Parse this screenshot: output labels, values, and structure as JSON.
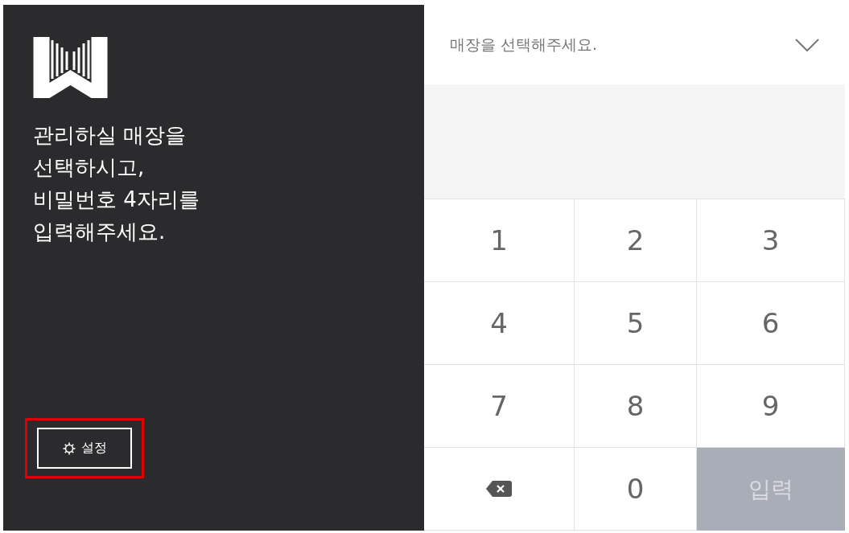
{
  "intro": {
    "lines": [
      "관리하실 매장을",
      "선택하시고,",
      "비밀번호 4자리를",
      "입력해주세요."
    ]
  },
  "settings": {
    "label": "설정",
    "highlighted": true
  },
  "store_select": {
    "placeholder": "매장을 선택해주세요."
  },
  "keypad": [
    {
      "kind": "digit",
      "label": "1"
    },
    {
      "kind": "digit",
      "label": "2"
    },
    {
      "kind": "digit",
      "label": "3"
    },
    {
      "kind": "digit",
      "label": "4"
    },
    {
      "kind": "digit",
      "label": "5"
    },
    {
      "kind": "digit",
      "label": "6"
    },
    {
      "kind": "digit",
      "label": "7"
    },
    {
      "kind": "digit",
      "label": "8"
    },
    {
      "kind": "digit",
      "label": "9"
    },
    {
      "kind": "backspace"
    },
    {
      "kind": "digit",
      "label": "0"
    },
    {
      "kind": "enter",
      "label": "입력",
      "disabled": true
    }
  ]
}
